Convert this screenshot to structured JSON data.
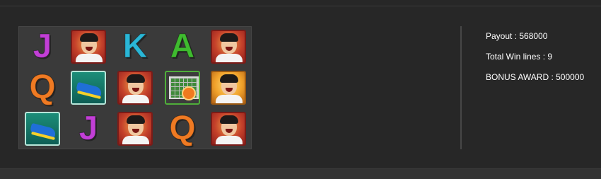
{
  "reel_grid": {
    "rows": [
      [
        "J",
        "player",
        "K",
        "A",
        "player"
      ],
      [
        "Q",
        "boot",
        "player",
        "goal",
        "player-gold"
      ],
      [
        "boot",
        "J",
        "player",
        "Q",
        "player"
      ]
    ]
  },
  "summary": {
    "payout_label": "Payout : 568000",
    "total_win_lines_label": "Total Win lines : 9",
    "bonus_award_label": "BONUS AWARD : 500000"
  },
  "colors": {
    "background": "#272727",
    "letter_J": "#c23fd6",
    "letter_K": "#2ab6d6",
    "letter_A": "#3fbb2f",
    "letter_Q": "#ef7a23"
  }
}
